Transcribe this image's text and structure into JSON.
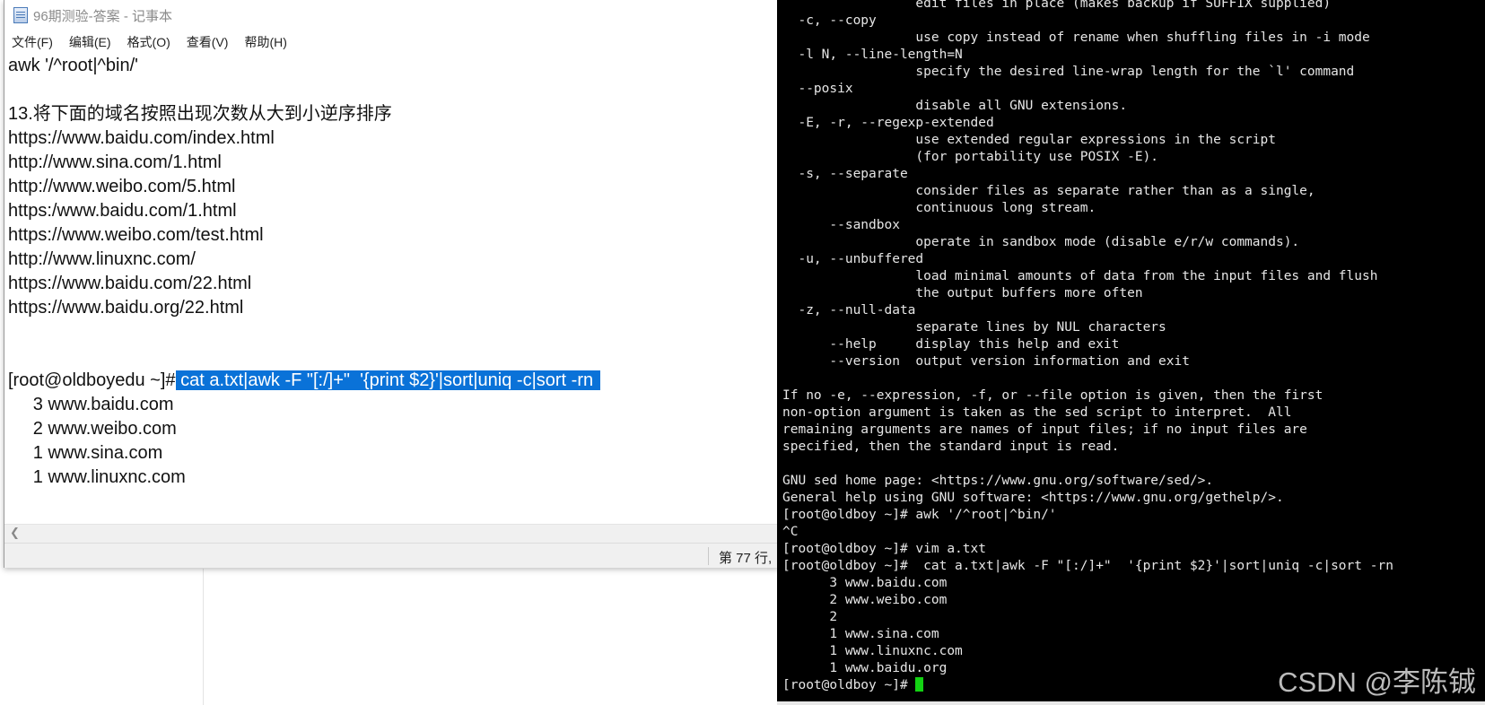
{
  "notepad": {
    "title": "96期测验-答案 - 记事本",
    "menus": [
      "文件(F)",
      "编辑(E)",
      "格式(O)",
      "查看(V)",
      "帮助(H)"
    ],
    "lines": [
      {
        "text": "awk '/^root|^bin/'"
      },
      {
        "text": ""
      },
      {
        "text": "13.将下面的域名按照出现次数从大到小逆序排序"
      },
      {
        "text": "https://www.baidu.com/index.html"
      },
      {
        "text": "http://www.sina.com/1.html"
      },
      {
        "text": "http://www.weibo.com/5.html"
      },
      {
        "text": "https:/www.baidu.com/1.html"
      },
      {
        "text": "https://www.weibo.com/test.html"
      },
      {
        "text": "http://www.linuxnc.com/"
      },
      {
        "text": "https://www.baidu.com/22.html"
      },
      {
        "text": "https://www.baidu.org/22.html"
      },
      {
        "text": ""
      },
      {
        "text": ""
      },
      {
        "prompt": "[root@oldboyedu ~]#",
        "selected": " cat a.txt|awk -F \"[:/]+\"  '{print $2}'|sort|uniq -c|sort -rn "
      },
      {
        "text": "     3 www.baidu.com"
      },
      {
        "text": "     2 www.weibo.com"
      },
      {
        "text": "     1 www.sina.com"
      },
      {
        "text": "     1 www.linuxnc.com"
      }
    ],
    "status_position": "第 77 行,"
  },
  "terminal": {
    "lines": [
      "                 edit files in place (makes backup if SUFFIX supplied)",
      "  -c, --copy",
      "                 use copy instead of rename when shuffling files in -i mode",
      "  -l N, --line-length=N",
      "                 specify the desired line-wrap length for the `l' command",
      "  --posix",
      "                 disable all GNU extensions.",
      "  -E, -r, --regexp-extended",
      "                 use extended regular expressions in the script",
      "                 (for portability use POSIX -E).",
      "  -s, --separate",
      "                 consider files as separate rather than as a single,",
      "                 continuous long stream.",
      "      --sandbox",
      "                 operate in sandbox mode (disable e/r/w commands).",
      "  -u, --unbuffered",
      "                 load minimal amounts of data from the input files and flush",
      "                 the output buffers more often",
      "  -z, --null-data",
      "                 separate lines by NUL characters",
      "      --help     display this help and exit",
      "      --version  output version information and exit",
      "",
      "If no -e, --expression, -f, or --file option is given, then the first",
      "non-option argument is taken as the sed script to interpret.  All",
      "remaining arguments are names of input files; if no input files are",
      "specified, then the standard input is read.",
      "",
      "GNU sed home page: <https://www.gnu.org/software/sed/>.",
      "General help using GNU software: <https://www.gnu.org/gethelp/>.",
      "[root@oldboy ~]# awk '/^root|^bin/'",
      "^C",
      "[root@oldboy ~]# vim a.txt",
      "[root@oldboy ~]#  cat a.txt|awk -F \"[:/]+\"  '{print $2}'|sort|uniq -c|sort -rn",
      "      3 www.baidu.com",
      "      2 www.weibo.com",
      "      2",
      "      1 www.sina.com",
      "      1 www.linuxnc.com",
      "      1 www.baidu.org"
    ],
    "last_prompt": "[root@oldboy ~]# ",
    "cursor_color": "#13d313"
  },
  "watermark": "CSDN @李陈铖"
}
